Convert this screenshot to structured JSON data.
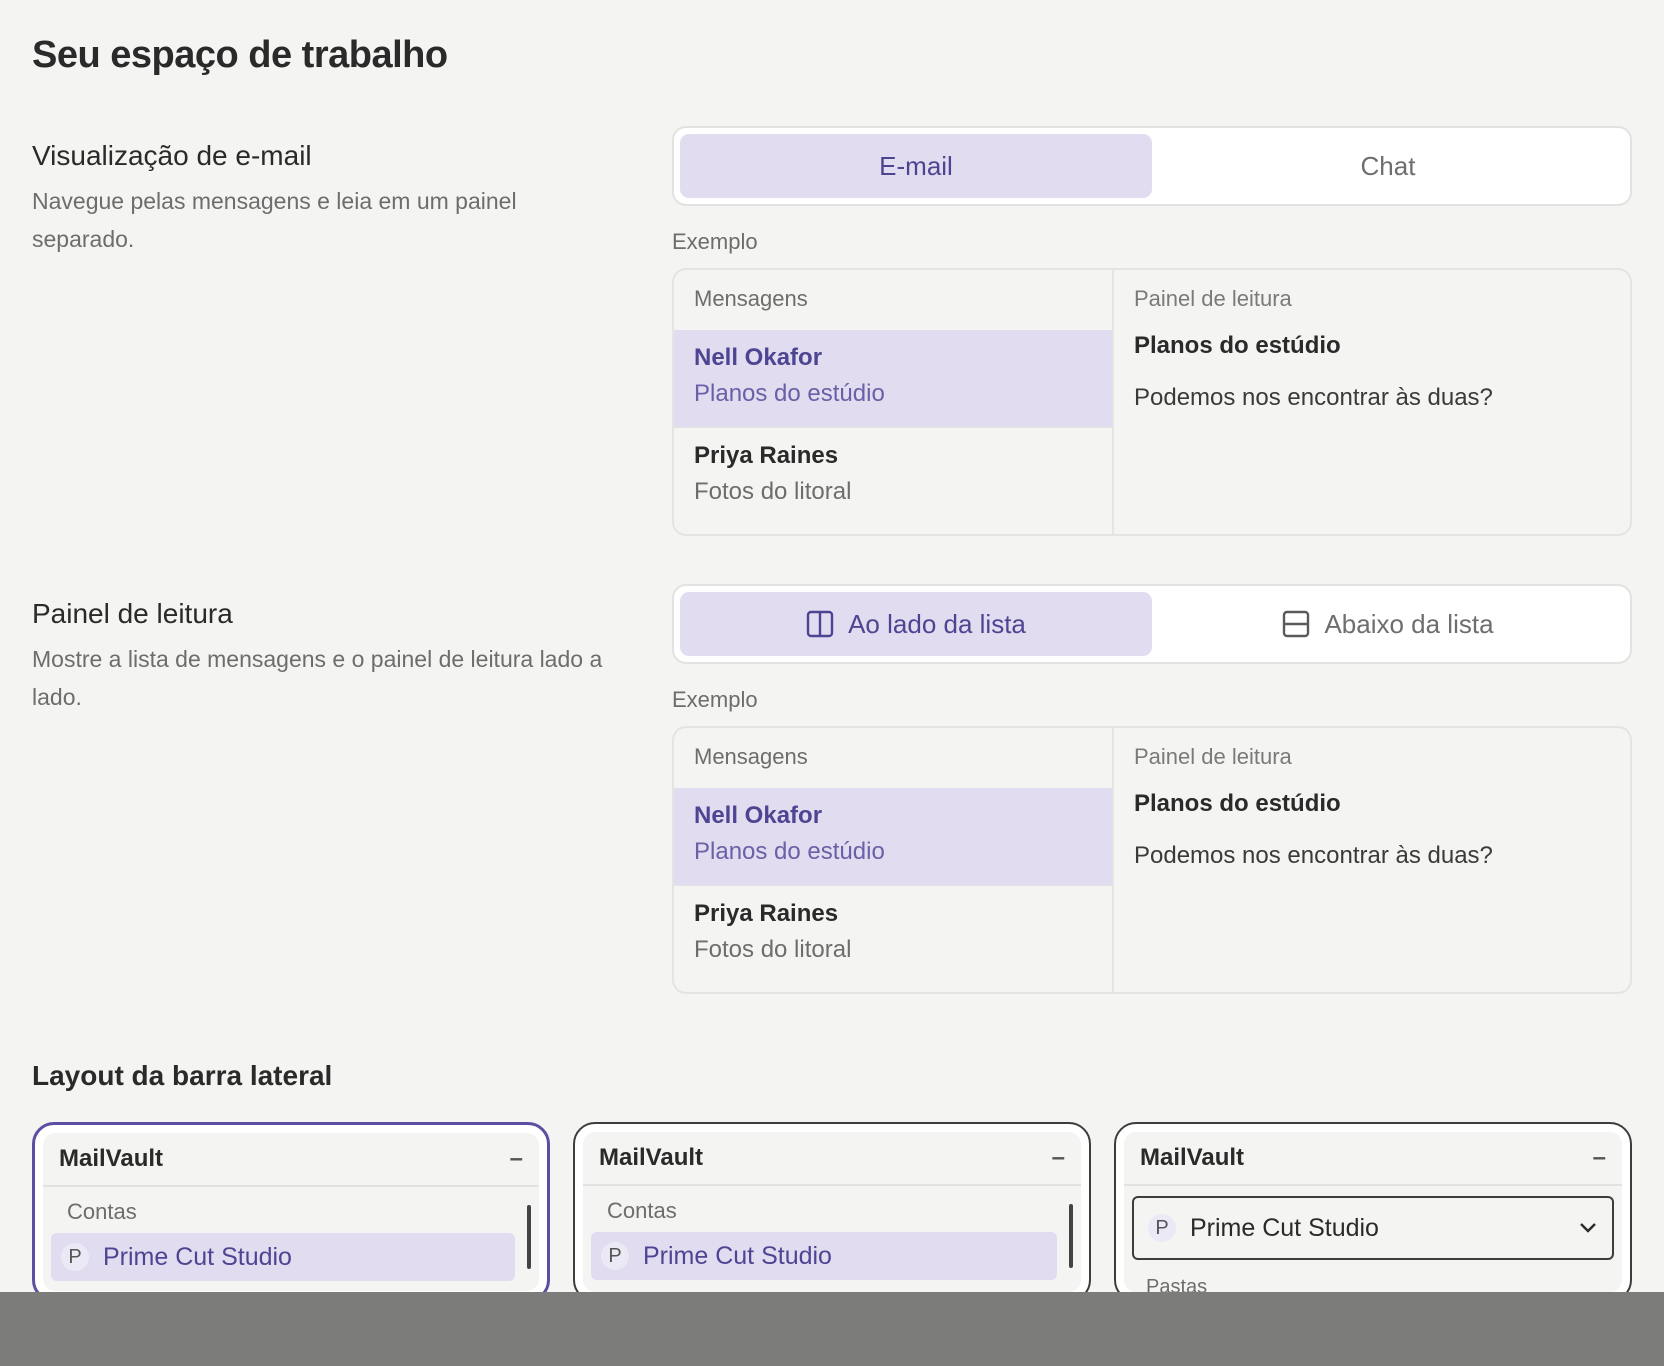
{
  "page": {
    "title": "Seu espaço de trabalho"
  },
  "email_view": {
    "title": "Visualização de e-mail",
    "description": "Navegue pelas mensagens e leia em um painel separado.",
    "options": [
      {
        "label": "E-mail",
        "active": true
      },
      {
        "label": "Chat",
        "active": false
      }
    ],
    "example_label": "Exemplo",
    "preview": {
      "list_header": "Mensagens",
      "messages": [
        {
          "from": "Nell Okafor",
          "subject": "Planos do estúdio",
          "active": true
        },
        {
          "from": "Priya Raines",
          "subject": "Fotos do litoral",
          "active": false
        }
      ],
      "reading_label": "Painel de leitura",
      "reading_title": "Planos do estúdio",
      "reading_body": "Podemos nos encontrar às duas?"
    }
  },
  "reading_pane": {
    "title": "Painel de leitura",
    "description": "Mostre a lista de mensagens e o painel de leitura lado a lado.",
    "options": [
      {
        "label": "Ao lado da lista",
        "icon": "split-vertical-icon",
        "active": true
      },
      {
        "label": "Abaixo da lista",
        "icon": "split-horizontal-icon",
        "active": false
      }
    ],
    "example_label": "Exemplo",
    "preview": {
      "list_header": "Mensagens",
      "messages": [
        {
          "from": "Nell Okafor",
          "subject": "Planos do estúdio",
          "active": true
        },
        {
          "from": "Priya Raines",
          "subject": "Fotos do litoral",
          "active": false
        }
      ],
      "reading_label": "Painel de leitura",
      "reading_title": "Planos do estúdio",
      "reading_body": "Podemos nos encontrar às duas?"
    }
  },
  "sidebar_layout": {
    "title": "Layout da barra lateral",
    "cards": [
      {
        "brand": "MailVault",
        "minimize": "–",
        "section": "Contas",
        "account_initial": "P",
        "account": "Prime Cut Studio",
        "selected": true
      },
      {
        "brand": "MailVault",
        "minimize": "–",
        "section": "Contas",
        "account_initial": "P",
        "account": "Prime Cut Studio",
        "selected": false
      },
      {
        "brand": "MailVault",
        "minimize": "–",
        "account_initial": "P",
        "account": "Prime Cut Studio",
        "section": "Pastas",
        "selected": false
      }
    ]
  },
  "colors": {
    "accent": "#5a4fa0",
    "accent_bg": "#e1dcf0",
    "background": "#f4f4f2"
  }
}
